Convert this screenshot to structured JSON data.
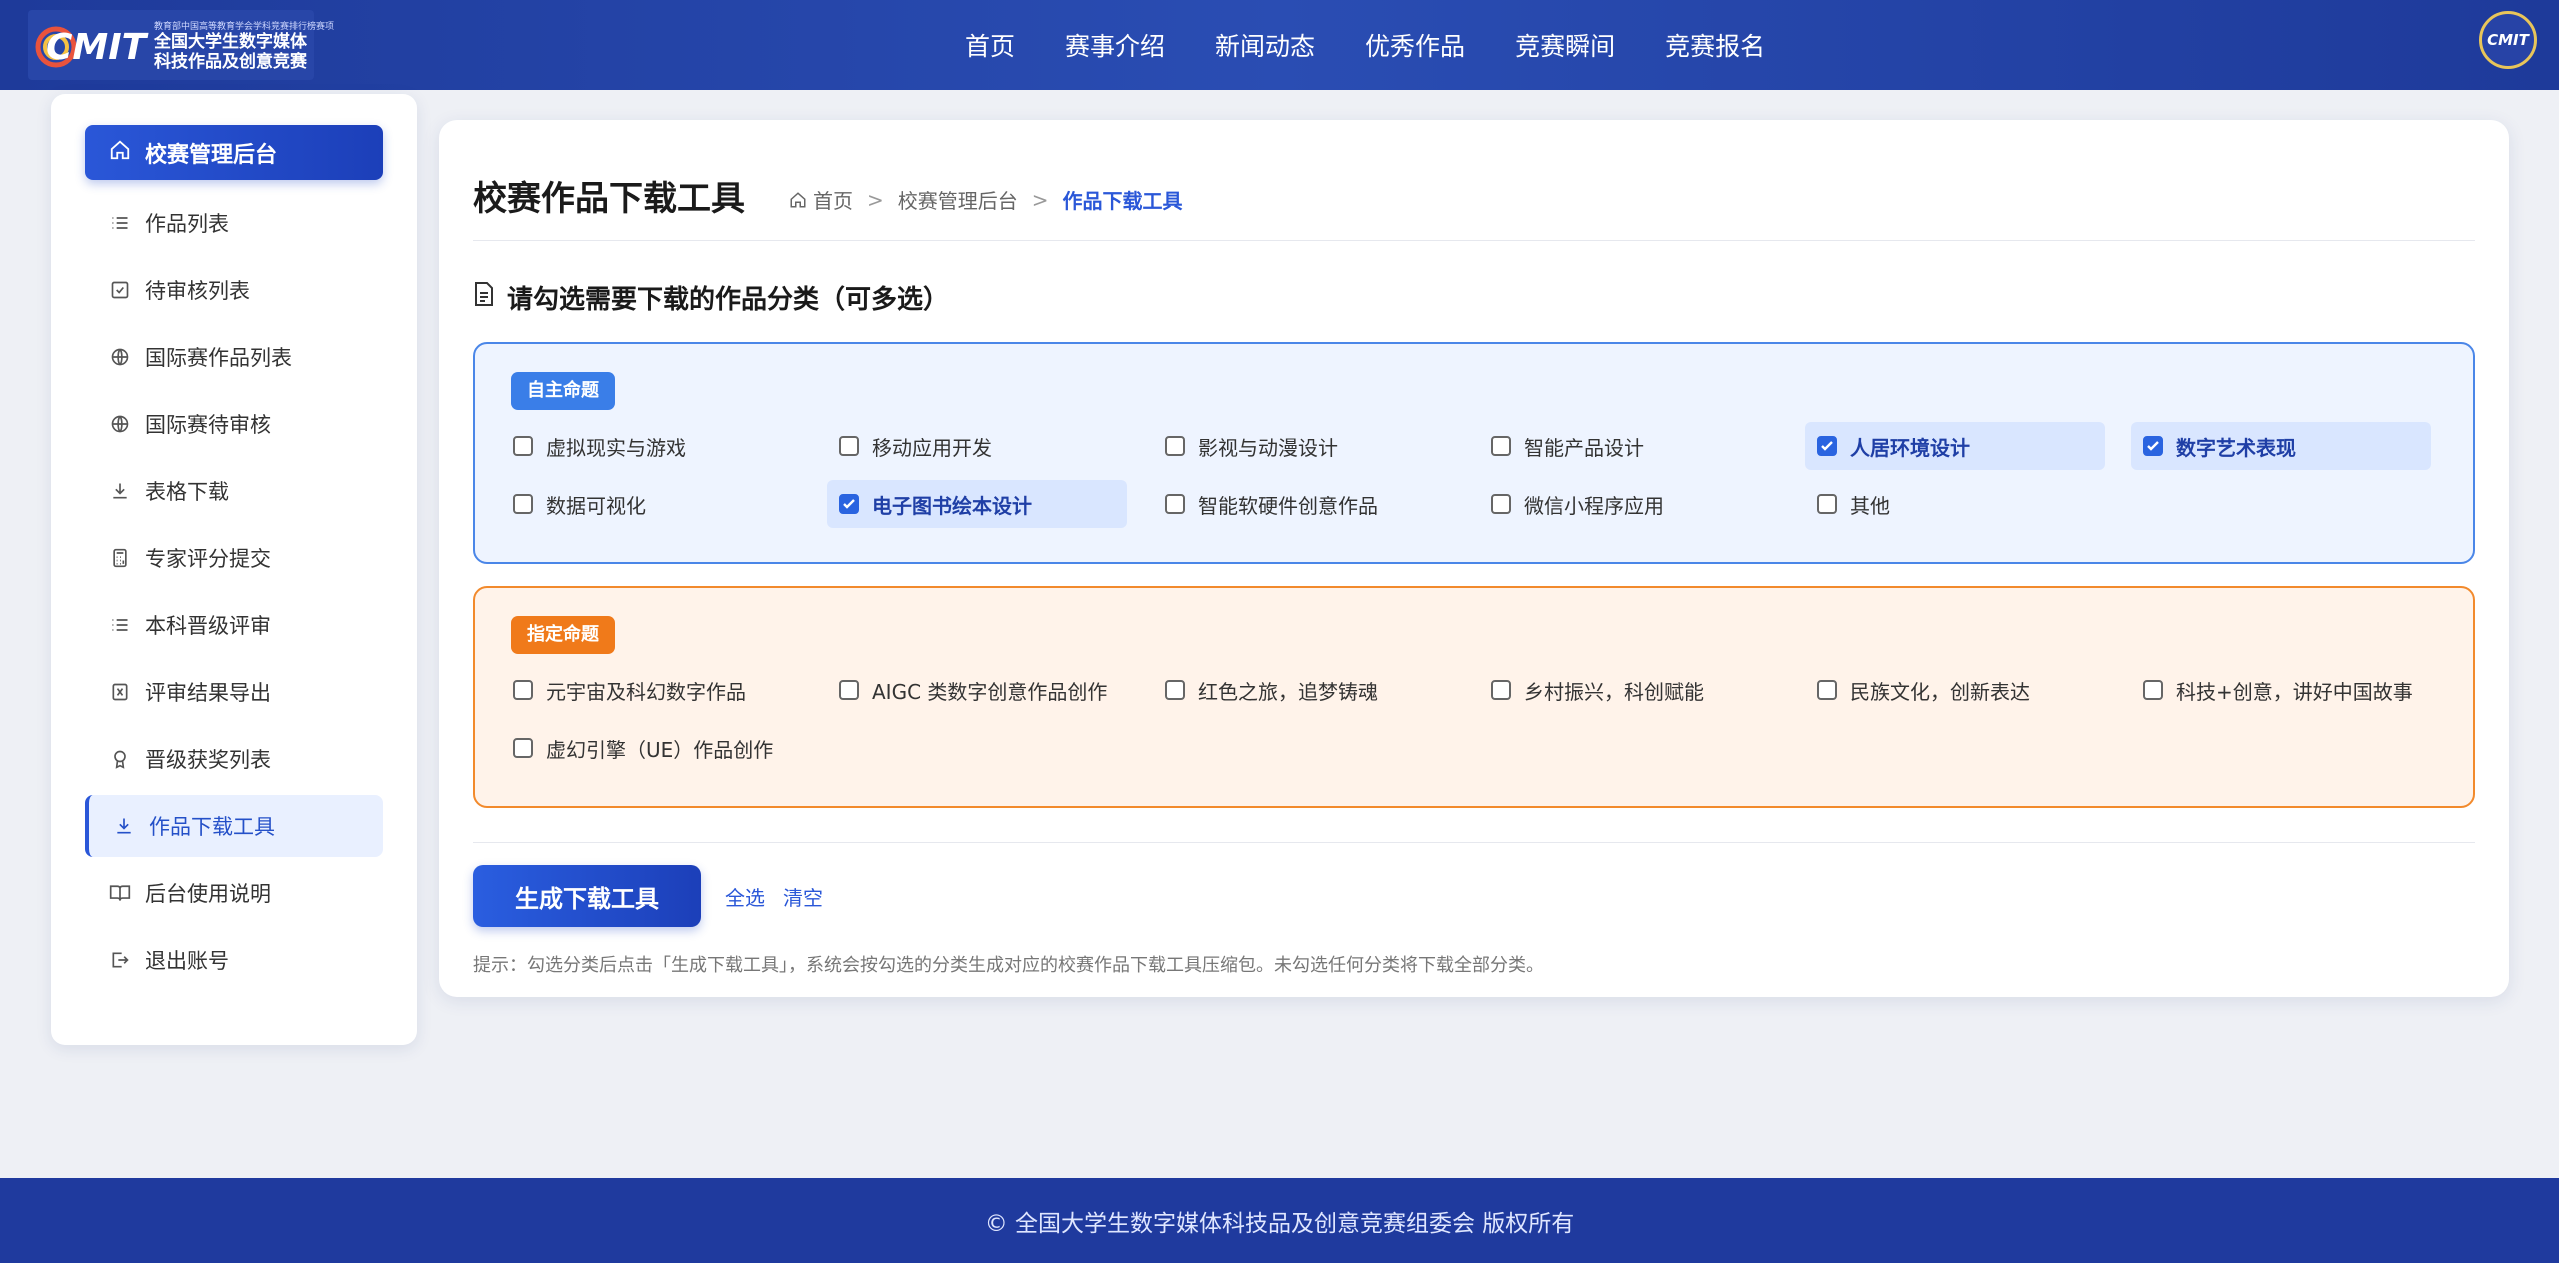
{
  "header": {
    "logo": {
      "mark_text": "CMIT",
      "small_line": "教育部中国高等教育学会学科竞赛排行榜赛项",
      "line1": "全国大学生数字媒体",
      "line2": "科技作品及创意竞赛"
    },
    "nav": [
      "首页",
      "赛事介绍",
      "新闻动态",
      "优秀作品",
      "竞赛瞬间",
      "竞赛报名"
    ],
    "avatar_text": "CMIT"
  },
  "sidebar": {
    "head": {
      "label": "校赛管理后台",
      "icon": "home-icon"
    },
    "items": [
      {
        "label": "作品列表",
        "icon": "list-icon"
      },
      {
        "label": "待审核列表",
        "icon": "checkbox-icon"
      },
      {
        "label": "国际赛作品列表",
        "icon": "globe-icon"
      },
      {
        "label": "国际赛待审核",
        "icon": "globe-icon"
      },
      {
        "label": "表格下载",
        "icon": "download-icon"
      },
      {
        "label": "专家评分提交",
        "icon": "calculator-icon"
      },
      {
        "label": "本科晋级评审",
        "icon": "list-icon"
      },
      {
        "label": "评审结果导出",
        "icon": "excel-icon"
      },
      {
        "label": "晋级获奖列表",
        "icon": "award-icon"
      },
      {
        "label": "作品下载工具",
        "icon": "download-icon",
        "active": true
      },
      {
        "label": "后台使用说明",
        "icon": "book-icon"
      },
      {
        "label": "退出账号",
        "icon": "logout-icon"
      }
    ]
  },
  "main": {
    "title": "校赛作品下载工具",
    "breadcrumb": [
      "首页",
      "校赛管理后台",
      "作品下载工具"
    ],
    "section_title": "请勾选需要下载的作品分类（可多选）",
    "groups": [
      {
        "tag": "自主命题",
        "options": [
          {
            "label": "虚拟现实与游戏",
            "checked": false
          },
          {
            "label": "移动应用开发",
            "checked": false
          },
          {
            "label": "影视与动漫设计",
            "checked": false
          },
          {
            "label": "智能产品设计",
            "checked": false
          },
          {
            "label": "人居环境设计",
            "checked": true
          },
          {
            "label": "数字艺术表现",
            "checked": true
          },
          {
            "label": "数据可视化",
            "checked": false
          },
          {
            "label": "电子图书绘本设计",
            "checked": true
          },
          {
            "label": "智能软硬件创意作品",
            "checked": false
          },
          {
            "label": "微信小程序应用",
            "checked": false
          },
          {
            "label": "其他",
            "checked": false
          }
        ]
      },
      {
        "tag": "指定命题",
        "options": [
          {
            "label": "元宇宙及科幻数字作品",
            "checked": false
          },
          {
            "label": "AIGC 类数字创意作品创作",
            "checked": false
          },
          {
            "label": "红色之旅，追梦铸魂",
            "checked": false
          },
          {
            "label": "乡村振兴，科创赋能",
            "checked": false
          },
          {
            "label": "民族文化，创新表达",
            "checked": false
          },
          {
            "label": "科技+创意，讲好中国故事",
            "checked": false
          },
          {
            "label": "虚幻引擎（UE）作品创作",
            "checked": false
          }
        ]
      }
    ],
    "generate_button": "生成下载工具",
    "select_all": "全选",
    "clear": "清空",
    "hint": "提示：勾选分类后点击「生成下载工具」，系统会按勾选的分类生成对应的校赛作品下载工具压缩包。未勾选任何分类将下载全部分类。"
  },
  "footer": {
    "text": "© 全国大学生数字媒体科技品及创意竞赛组委会 版权所有"
  },
  "colors": {
    "primary": "#2a57d8",
    "header": "#1e3a9a",
    "blue_group": "#4a86e8",
    "orange_group": "#f28a2c"
  }
}
